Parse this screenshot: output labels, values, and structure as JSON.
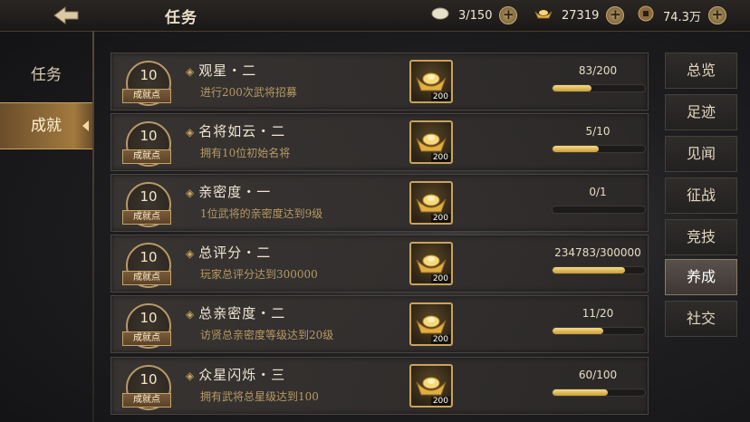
{
  "header": {
    "title": "任务",
    "resources": [
      {
        "icon": "egg-icon",
        "value": "3/150"
      },
      {
        "icon": "gold-ingot-icon",
        "value": "27319"
      },
      {
        "icon": "copper-coin-icon",
        "value": "74.3万"
      }
    ]
  },
  "left_tabs": [
    {
      "label": "任务"
    },
    {
      "label": "成就"
    }
  ],
  "right_tabs": [
    {
      "label": "总览"
    },
    {
      "label": "足迹"
    },
    {
      "label": "见闻"
    },
    {
      "label": "征战"
    },
    {
      "label": "竞技"
    },
    {
      "label": "养成"
    },
    {
      "label": "社交"
    }
  ],
  "active_left": "成就",
  "active_right": "养成",
  "achievements": [
    {
      "points": "10",
      "points_label": "成就点",
      "name": "观星・二",
      "desc": "进行200次武将招募",
      "reward_amount": "200",
      "progress_text": "83/200",
      "progress": 0.415
    },
    {
      "points": "10",
      "points_label": "成就点",
      "name": "名将如云・二",
      "desc": "拥有10位初始名将",
      "reward_amount": "200",
      "progress_text": "5/10",
      "progress": 0.5
    },
    {
      "points": "10",
      "points_label": "成就点",
      "name": "亲密度・一",
      "desc": "1位武将的亲密度达到9级",
      "reward_amount": "200",
      "progress_text": "0/1",
      "progress": 0.0
    },
    {
      "points": "10",
      "points_label": "成就点",
      "name": "总评分・二",
      "desc": "玩家总评分达到300000",
      "reward_amount": "200",
      "progress_text": "234783/300000",
      "progress": 0.783
    },
    {
      "points": "10",
      "points_label": "成就点",
      "name": "总亲密度・二",
      "desc": "访贤总亲密度等级达到20级",
      "reward_amount": "200",
      "progress_text": "11/20",
      "progress": 0.55
    },
    {
      "points": "10",
      "points_label": "成就点",
      "name": "众星闪烁・三",
      "desc": "拥有武将总星级达到100",
      "reward_amount": "200",
      "progress_text": "60/100",
      "progress": 0.6
    }
  ]
}
